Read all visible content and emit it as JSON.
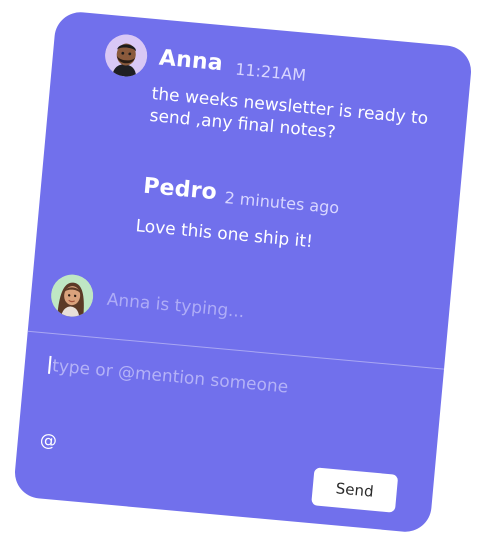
{
  "messages": [
    {
      "sender": "Anna",
      "time": "11:21AM",
      "text": "the weeks newsletter is ready to send ,any final notes?",
      "avatar": "memoji-man-avatar"
    },
    {
      "sender": "Pedro",
      "time": "2 minutes ago",
      "text": "Love this one ship it!"
    }
  ],
  "typing": {
    "text": "Anna is typing...",
    "avatar": "memoji-woman-avatar"
  },
  "composer": {
    "placeholder": "type or @mention someone",
    "mention_icon": "@",
    "send_label": "Send"
  },
  "colors": {
    "card_background": "#7170ec",
    "muted_text": "#aeacf7",
    "button_background": "#ffffff"
  }
}
